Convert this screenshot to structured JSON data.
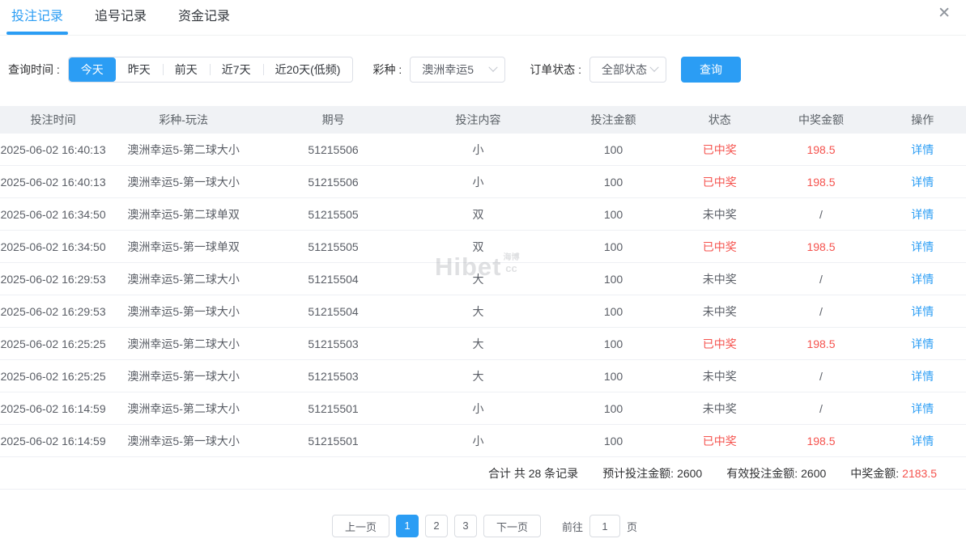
{
  "colors": {
    "accent_blue": "#2b9df4",
    "win_red": "#f5524d",
    "header_bg": "#f0f2f5",
    "link_blue": "#2b9df4"
  },
  "icons": {
    "close": "✕"
  },
  "tabs": [
    {
      "label": "投注记录",
      "active": true
    },
    {
      "label": "追号记录",
      "active": false
    },
    {
      "label": "资金记录",
      "active": false
    }
  ],
  "filters": {
    "time_label": "查询时间 :",
    "time_options": [
      {
        "label": "今天",
        "active": true
      },
      {
        "label": "昨天",
        "active": false
      },
      {
        "label": "前天",
        "active": false
      },
      {
        "label": "近7天",
        "active": false
      },
      {
        "label": "近20天(低频)",
        "active": false
      }
    ],
    "lottery_label": "彩种 :",
    "lottery_value": "澳洲幸运5",
    "status_label": "订单状态 :",
    "status_value": "全部状态",
    "query_button": "查询"
  },
  "table": {
    "headers": [
      "投注时间",
      "彩种-玩法",
      "期号",
      "投注内容",
      "投注金额",
      "状态",
      "中奖金额",
      "操作"
    ],
    "action_label": "详情",
    "rows": [
      {
        "time": "2025-06-02 16:40:13",
        "play": "澳洲幸运5-第二球大小",
        "issue": "51215506",
        "content": "小",
        "amount": "100",
        "status": "已中奖",
        "won": true,
        "prize": "198.5"
      },
      {
        "time": "2025-06-02 16:40:13",
        "play": "澳洲幸运5-第一球大小",
        "issue": "51215506",
        "content": "小",
        "amount": "100",
        "status": "已中奖",
        "won": true,
        "prize": "198.5"
      },
      {
        "time": "2025-06-02 16:34:50",
        "play": "澳洲幸运5-第二球单双",
        "issue": "51215505",
        "content": "双",
        "amount": "100",
        "status": "未中奖",
        "won": false,
        "prize": "/"
      },
      {
        "time": "2025-06-02 16:34:50",
        "play": "澳洲幸运5-第一球单双",
        "issue": "51215505",
        "content": "双",
        "amount": "100",
        "status": "已中奖",
        "won": true,
        "prize": "198.5"
      },
      {
        "time": "2025-06-02 16:29:53",
        "play": "澳洲幸运5-第二球大小",
        "issue": "51215504",
        "content": "大",
        "amount": "100",
        "status": "未中奖",
        "won": false,
        "prize": "/"
      },
      {
        "time": "2025-06-02 16:29:53",
        "play": "澳洲幸运5-第一球大小",
        "issue": "51215504",
        "content": "大",
        "amount": "100",
        "status": "未中奖",
        "won": false,
        "prize": "/"
      },
      {
        "time": "2025-06-02 16:25:25",
        "play": "澳洲幸运5-第二球大小",
        "issue": "51215503",
        "content": "大",
        "amount": "100",
        "status": "已中奖",
        "won": true,
        "prize": "198.5"
      },
      {
        "time": "2025-06-02 16:25:25",
        "play": "澳洲幸运5-第一球大小",
        "issue": "51215503",
        "content": "大",
        "amount": "100",
        "status": "未中奖",
        "won": false,
        "prize": "/"
      },
      {
        "time": "2025-06-02 16:14:59",
        "play": "澳洲幸运5-第二球大小",
        "issue": "51215501",
        "content": "小",
        "amount": "100",
        "status": "未中奖",
        "won": false,
        "prize": "/"
      },
      {
        "time": "2025-06-02 16:14:59",
        "play": "澳洲幸运5-第一球大小",
        "issue": "51215501",
        "content": "小",
        "amount": "100",
        "status": "已中奖",
        "won": true,
        "prize": "198.5"
      }
    ]
  },
  "summary": {
    "total_text": "合计 共 28 条记录",
    "expected_label": "预计投注金额:",
    "expected_value": "2600",
    "valid_label": "有效投注金额:",
    "valid_value": "2600",
    "prize_label": "中奖金额:",
    "prize_value": "2183.5"
  },
  "pagination": {
    "prev_label": "上一页",
    "pages": [
      "1",
      "2",
      "3"
    ],
    "active_page": "1",
    "next_label": "下一页",
    "goto_label": "前往",
    "goto_value": "1",
    "goto_unit": "页"
  },
  "watermark": {
    "text": "Hibet",
    "sub_top": "海博",
    "sub_bottom": "cc"
  }
}
